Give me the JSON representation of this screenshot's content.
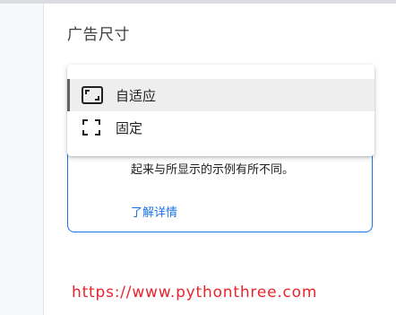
{
  "section": {
    "title": "广告尺寸"
  },
  "dropdown": {
    "options": [
      {
        "label": "自适应",
        "icon": "responsive-icon",
        "selected": true
      },
      {
        "label": "固定",
        "icon": "fixed-size-icon",
        "selected": false
      }
    ]
  },
  "info": {
    "text": "起来与所显示的示例有所不同。",
    "link": "了解详情"
  },
  "watermark": "https://www.pythonthree.com",
  "colors": {
    "accent": "#1a73e8",
    "watermark": "#e8242d",
    "selected_bg": "#eeeeee"
  }
}
